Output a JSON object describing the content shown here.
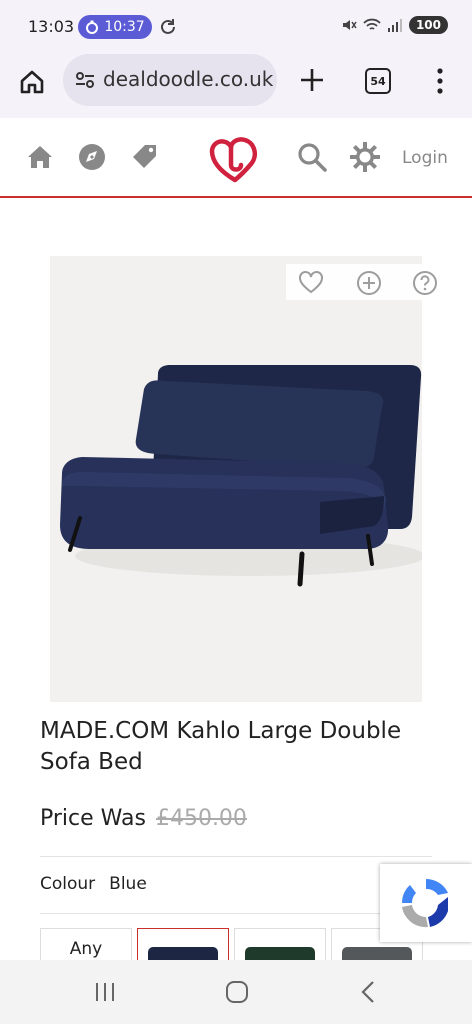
{
  "status_bar": {
    "time": "13:03",
    "timer": "10:37",
    "battery": "100"
  },
  "browser": {
    "url": "dealdoodle.co.uk",
    "tab_count": "54"
  },
  "site_header": {
    "login_label": "Login",
    "brand_color": "#d0223f",
    "accent_color": "#c9302c"
  },
  "product": {
    "title": "MADE.COM Kahlo Large Double Sofa Bed",
    "price_label": "Price Was",
    "price_was": "£450.00",
    "colour_label": "Colour",
    "colour_value": "Blue",
    "swatches": [
      {
        "label": "Any"
      },
      {
        "color": "#1d2744"
      },
      {
        "color": "#1f3a2b"
      },
      {
        "color": "#55585a"
      }
    ]
  },
  "icons": [
    "home-icon",
    "tune-icon",
    "plus-icon",
    "tabs-icon",
    "menu-icon",
    "site-home-icon",
    "compass-icon",
    "tag-icon",
    "brand-logo",
    "search-icon",
    "settings-icon",
    "heart-icon",
    "add-icon",
    "help-icon",
    "recaptcha-icon",
    "recent-apps-icon",
    "home-nav-icon",
    "back-icon"
  ]
}
